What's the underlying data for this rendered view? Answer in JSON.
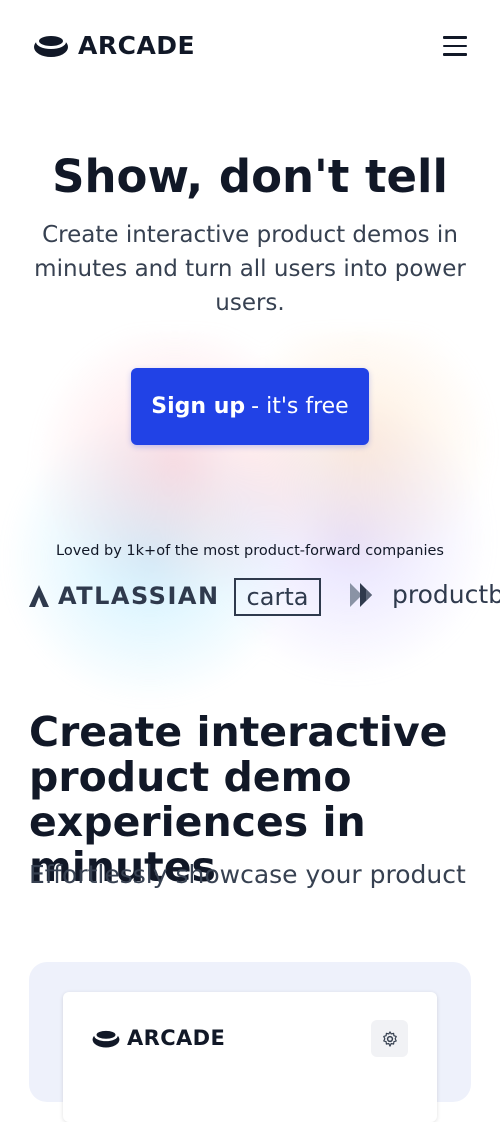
{
  "navbar": {
    "brand": "ARCADE",
    "menu_icon": "hamburger-menu-icon"
  },
  "hero": {
    "title": "Show, don't tell",
    "subtitle": "Create interactive product demos in minutes and turn all users into power users.",
    "cta_bold": "Sign up",
    "cta_rest": "- it's free"
  },
  "social_proof": {
    "text": "Loved by 1k+of the most product-forward companies",
    "logos": [
      "ATLASSIAN",
      "carta",
      "productboard"
    ]
  },
  "feature": {
    "title": "Create interactive product demo experiences in minutes",
    "subtitle": "Effortlessly showcase your product"
  },
  "preview": {
    "brand": "ARCADE",
    "settings_icon": "gear-icon"
  },
  "colors": {
    "accent": "#2142e6",
    "text": "#111827",
    "logo_gray": "#2f3a4d"
  }
}
